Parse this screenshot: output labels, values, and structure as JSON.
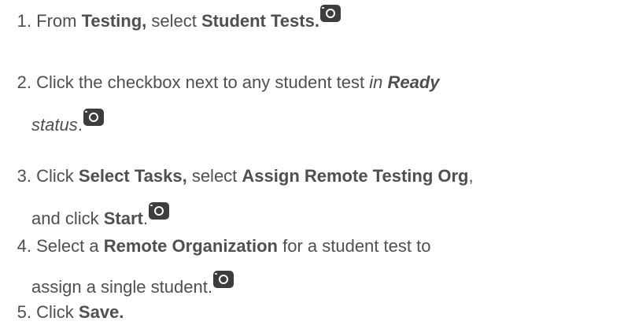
{
  "steps": [
    {
      "num": "1.",
      "t1": "From ",
      "b1": "Testing,",
      "t2": " select ",
      "b2": "Student Tests.",
      "icon": "camera-icon"
    },
    {
      "num": "2.",
      "t1": "Click the checkbox next to any student test ",
      "i1": "in ",
      "bi1": "Ready",
      "i2": "status",
      "t2": ".",
      "icon": "camera-icon"
    },
    {
      "num": "3.",
      "t1": "Click ",
      "b1": "Select Tasks,",
      "t2": " select ",
      "b2": "Assign Remote Testing Org",
      "t3": ",",
      "t4": "and click ",
      "b3": "Start",
      "t5": ".",
      "icon": "camera-icon"
    },
    {
      "num": "4.",
      "t1": "Select a ",
      "b1": "Remote Organization",
      "t2": " for a student test to",
      "t3": "assign a single student.",
      "icon": "camera-icon"
    },
    {
      "num": "5.",
      "t1": "Click ",
      "b1": "Save."
    }
  ]
}
